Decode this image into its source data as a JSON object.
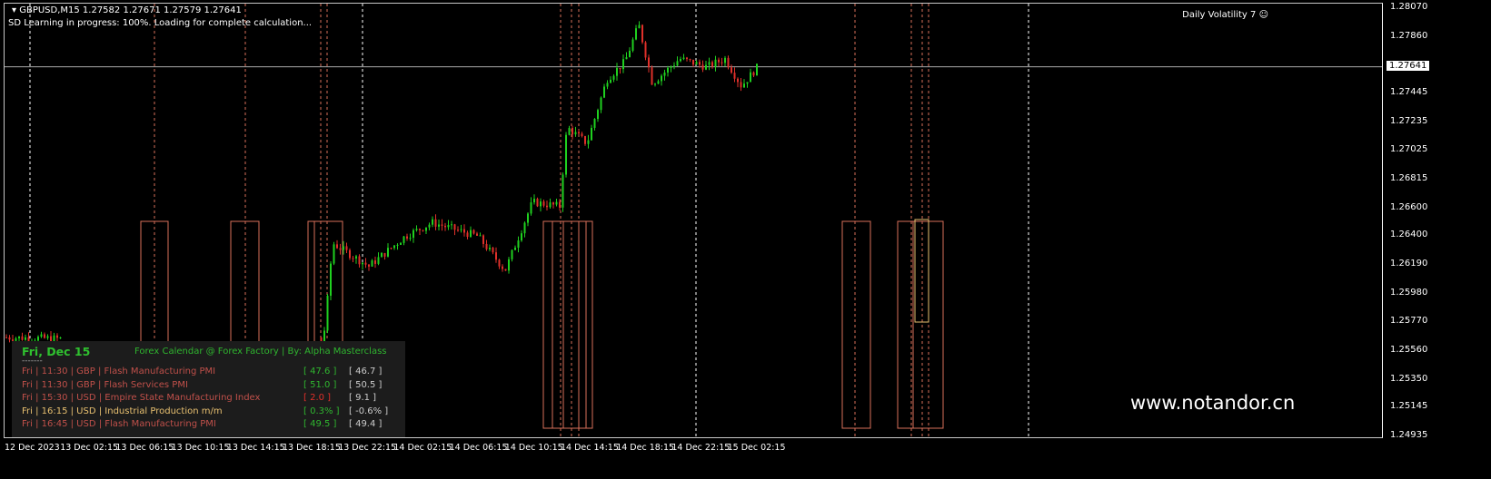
{
  "header": {
    "symbol_line": "GBPUSD,M15  1.27582 1.27671 1.27579 1.27641",
    "status": "SD Learning in progress: 100%. Loading for complete calculation..."
  },
  "indicator": {
    "label": "Daily Volatility 7",
    "icon": "smiley-icon"
  },
  "watermark": "www.notandor.cn",
  "calendar": {
    "date": "Fri, Dec 15",
    "title": "Forex Calendar @ Forex Factory | By: Alpha Masterclass",
    "separator": "-------",
    "events": [
      {
        "text": "Fri  |  11:30  |  GBP  |  Flash Manufacturing PMI",
        "actual": "[ 47.6 ]",
        "previous": "[ 46.7 ]",
        "color": "#c0504a",
        "actual_color": "#2fb52f"
      },
      {
        "text": "Fri  |  11:30  |  GBP  |  Flash Services PMI",
        "actual": "[ 51.0 ]",
        "previous": "[ 50.5 ]",
        "color": "#c0504a",
        "actual_color": "#2fb52f"
      },
      {
        "text": "Fri  |  15:30  |  USD  |  Empire State Manufacturing Index",
        "actual": "[ 2.0 ]",
        "previous": "[ 9.1 ]",
        "color": "#c0504a",
        "actual_color": "#e0302a"
      },
      {
        "text": "Fri  |  16:15  |  USD  |  Industrial Production m/m",
        "actual": "[ 0.3% ]",
        "previous": "[ -0.6% ]",
        "color": "#e8c070",
        "actual_color": "#2fb52f"
      },
      {
        "text": "Fri  |  16:45  |  USD  |  Flash Manufacturing PMI",
        "actual": "[ 49.5 ]",
        "previous": "[ 49.4 ]",
        "color": "#c0504a",
        "actual_color": "#2fb52f"
      }
    ]
  },
  "chart_data": {
    "type": "candlestick",
    "symbol": "GBPUSD",
    "timeframe": "M15",
    "ylim": [
      1.24935,
      1.2807
    ],
    "current_price": "1.27641",
    "price_labels": [
      "1.28070",
      "1.27860",
      "1.27445",
      "1.27235",
      "1.27025",
      "1.26815",
      "1.26600",
      "1.26400",
      "1.26190",
      "1.25980",
      "1.25770",
      "1.25560",
      "1.25350",
      "1.25145",
      "1.24935"
    ],
    "time_labels": [
      "12 Dec 2023",
      "13 Dec 02:15",
      "13 Dec 06:15",
      "13 Dec 10:15",
      "13 Dec 14:15",
      "13 Dec 18:15",
      "13 Dec 22:15",
      "14 Dec 02:15",
      "14 Dec 06:15",
      "14 Dec 10:15",
      "14 Dec 14:15",
      "14 Dec 18:15",
      "14 Dec 22:15",
      "15 Dec 02:15"
    ],
    "price_path": [
      [
        0,
        1.2566
      ],
      [
        60,
        1.2565
      ],
      [
        345,
        1.255
      ],
      [
        352,
        1.2575
      ],
      [
        360,
        1.2635
      ],
      [
        400,
        1.2618
      ],
      [
        440,
        1.264
      ],
      [
        470,
        1.265
      ],
      [
        520,
        1.264
      ],
      [
        550,
        1.2615
      ],
      [
        580,
        1.2665
      ],
      [
        610,
        1.2662
      ],
      [
        618,
        1.272
      ],
      [
        640,
        1.2708
      ],
      [
        662,
        1.2755
      ],
      [
        682,
        1.2768
      ],
      [
        697,
        1.2795
      ],
      [
        712,
        1.2752
      ],
      [
        742,
        1.277
      ],
      [
        772,
        1.2764
      ],
      [
        792,
        1.277
      ],
      [
        810,
        1.275
      ],
      [
        828,
        1.27641
      ]
    ]
  },
  "colors": {
    "bull": "#1fd01f",
    "bear": "#e0302a",
    "event": "#d9705a",
    "separator": "#ffffff"
  }
}
